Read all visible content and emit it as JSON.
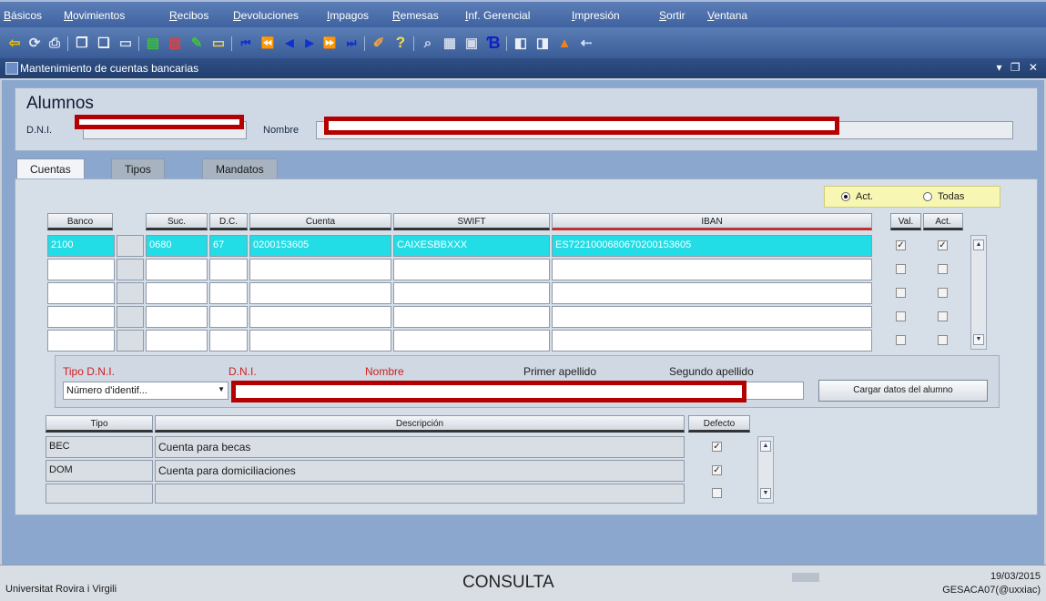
{
  "menu": [
    "Básicos",
    "Movimientos",
    "Recibos",
    "Devoluciones",
    "Impagos",
    "Remesas",
    "Inf. Gerencial",
    "Impresión",
    "Sortir",
    "Ventana"
  ],
  "menu_underlines": [
    "B",
    "M",
    "R",
    "D",
    "I",
    "R",
    "I",
    "I",
    "S",
    "V"
  ],
  "toolbar": {
    "icons": [
      "exit-icon",
      "refresh-icon",
      "print-icon",
      "copy-icon",
      "paste-icon",
      "clear-icon",
      "insert-record-icon",
      "delete-record-icon",
      "edit-icon",
      "clear-form-icon",
      "first-icon",
      "prev-block-icon",
      "prev-icon",
      "next-icon",
      "next-block-icon",
      "last-icon",
      "list-icon",
      "help-icon",
      "query-icon",
      "calendar-icon",
      "notes-icon",
      "editor-icon",
      "window1-icon",
      "window2-icon",
      "pdf-icon",
      "more-icon"
    ]
  },
  "window": {
    "title": "Mantenimiento de cuentas bancarias",
    "controls": "▾ ❐ ✕"
  },
  "alumnos": {
    "heading": "Alumnos",
    "dni_label": "D.N.I.",
    "nombre_label": "Nombre"
  },
  "tabs": [
    "Cuentas",
    "Tipos",
    "Mandatos"
  ],
  "toggle": {
    "act": "Act.",
    "todas": "Todas"
  },
  "accounts": {
    "headers": {
      "banco": "Banco",
      "suc": "Suc.",
      "dc": "D.C.",
      "cuenta": "Cuenta",
      "swift": "SWIFT",
      "iban": "IBAN",
      "val": "Val.",
      "act": "Act."
    },
    "rows": [
      {
        "banco": "2100",
        "suc": "0680",
        "dc": "67",
        "cuenta": "0200153605",
        "swift": "CAIXESBBXXX",
        "iban": "ES7221000680670200153605",
        "val": true,
        "act": true
      },
      {
        "banco": "",
        "suc": "",
        "dc": "",
        "cuenta": "",
        "swift": "",
        "iban": "",
        "val": false,
        "act": false
      },
      {
        "banco": "",
        "suc": "",
        "dc": "",
        "cuenta": "",
        "swift": "",
        "iban": "",
        "val": false,
        "act": false
      },
      {
        "banco": "",
        "suc": "",
        "dc": "",
        "cuenta": "",
        "swift": "",
        "iban": "",
        "val": false,
        "act": false
      },
      {
        "banco": "",
        "suc": "",
        "dc": "",
        "cuenta": "",
        "swift": "",
        "iban": "",
        "val": false,
        "act": false
      }
    ]
  },
  "search": {
    "tipo_dni_label": "Tipo D.N.I.",
    "dni_label": "D.N.I.",
    "nombre_label": "Nombre",
    "primer_apellido_label": "Primer apellido",
    "segundo_apellido_label": "Segundo apellido",
    "tipo_dni_value": "Número d'identif...",
    "cargar_button": "Cargar datos del alumno"
  },
  "tipos": {
    "headers": {
      "tipo": "Tipo",
      "descripcion": "Descripción",
      "defecto": "Defecto"
    },
    "rows": [
      {
        "tipo": "BEC",
        "descripcion": "Cuenta para becas",
        "defecto": true
      },
      {
        "tipo": "DOM",
        "descripcion": "Cuenta para domiciliaciones",
        "defecto": true
      },
      {
        "tipo": "",
        "descripcion": "",
        "defecto": false
      }
    ]
  },
  "status": {
    "org": "Universitat Rovira i Virgili",
    "mode": "CONSULTA",
    "date": "19/03/2015",
    "user": "GESACA07(@uxxiac)"
  },
  "colors": {
    "selected_row": "#22dce6",
    "required_label": "#d22020",
    "redaction": "#b40000"
  }
}
